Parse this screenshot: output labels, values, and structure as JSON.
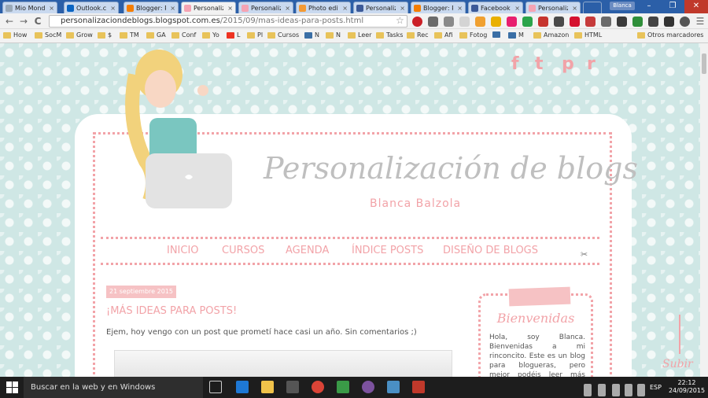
{
  "tabs": [
    {
      "title": "Mio Mond",
      "color": "#9aa9b8"
    },
    {
      "title": "Outlook.c",
      "color": "#0a64c2"
    },
    {
      "title": "Blogger: P",
      "color": "#f57d00"
    },
    {
      "title": "Personaliz",
      "color": "#f5a3b3",
      "active": true
    },
    {
      "title": "Personaliz",
      "color": "#f5a3b3"
    },
    {
      "title": "Photo edit",
      "color": "#f39a34"
    },
    {
      "title": "Personaliz",
      "color": "#3b5998"
    },
    {
      "title": "Blogger: P",
      "color": "#f57d00"
    },
    {
      "title": "Facebook",
      "color": "#3b5998"
    },
    {
      "title": "Personaliz",
      "color": "#f5a3b3"
    }
  ],
  "profile": "Blanca",
  "window": {
    "minimize": "–",
    "restore": "❐",
    "close": "✕"
  },
  "toolbar": {
    "back": "←",
    "forward": "→",
    "reload": "C",
    "url_host": "personalizaciondeblogs.blogspot.com.es",
    "url_path": "/2015/09/mas-ideas-para-posts.html",
    "star": "☆",
    "menu": "☰"
  },
  "bookmarks": [
    "How",
    "SocM",
    "Grow",
    "$",
    "TM",
    "GA",
    "Conf",
    "Yo",
    "L",
    "Pl",
    "Cursos",
    "N",
    "N",
    "Leer",
    "Tasks",
    "Rec",
    "Afi",
    "Fotog",
    "",
    "M",
    "Amazon",
    "HTML"
  ],
  "bookmarks_other": "Otros marcadores",
  "social_icons": [
    "facebook-icon",
    "twitter-icon",
    "pinterest-icon",
    "rss-icon"
  ],
  "social_glyphs": [
    "f",
    "t",
    "p",
    "r"
  ],
  "blog": {
    "title": "Personalización de blogs",
    "subtitle": "Blanca Balzola"
  },
  "nav": [
    "INICIO",
    "CURSOS",
    "AGENDA",
    "ÍNDICE POSTS",
    "DISEÑO DE BLOGS"
  ],
  "post": {
    "date": "21 septiembre 2015",
    "title": "¡MÁS IDEAS PARA POSTS!",
    "body": "Ejem, hoy vengo con un post que prometí hace casi un año. Sin comentarios ;)"
  },
  "sidebar": {
    "title": "Bienvenidas",
    "text": "Hola, soy Blanca. Bienvenidas a mi rinconcito. Este es un blog para blogueras, pero mejor podéis leer más detalladamente de"
  },
  "subir": "Subir",
  "taskbar": {
    "search": "Buscar en la web y en Windows",
    "lang": "ESP",
    "time": "22:12",
    "date": "24/09/2015"
  }
}
